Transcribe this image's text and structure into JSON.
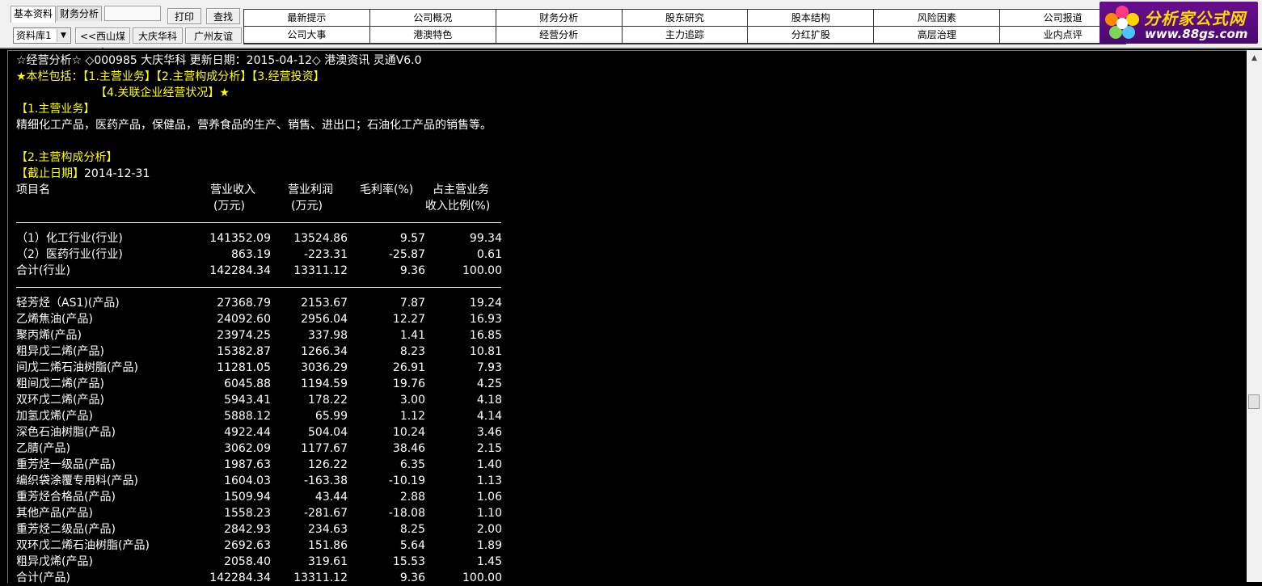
{
  "toolbar": {
    "tabs": [
      "基本资料",
      "财务分析"
    ],
    "print_label": "打印",
    "search_label": "查找",
    "select_value": "资料库1",
    "prev_stock": "<<西山煤电",
    "current_stock": "大庆华科",
    "next_stock": "广州友谊>>",
    "menu_row1": [
      "最新提示",
      "公司概况",
      "财务分析",
      "股东研究",
      "股本结构",
      "风险因素",
      "公司报道"
    ],
    "menu_row2": [
      "公司大事",
      "港澳特色",
      "经营分析",
      "主力追踪",
      "分红扩股",
      "高层治理",
      "业内点评"
    ]
  },
  "logo": {
    "name": "分析家公式网",
    "url": "www.88gs.com"
  },
  "content": {
    "title_line": "☆经营分析☆ ◇000985 大庆华科 更新日期：2015-04-12◇ 港澳资讯 灵通V6.0",
    "includes_line1": "★本栏包括：【1.主营业务】【2.主营构成分析】【3.经营投资】",
    "includes_line2": "【4.关联企业经营状况】★",
    "section1_title": "【1.主营业务】",
    "section1_body": "精细化工产品，医药产品，保健品，营养食品的生产、销售、进出口；石油化工产品的销售等。",
    "section2_title": "【2.主营构成分析】",
    "cutoff_label": "【截止日期】",
    "cutoff_date": "2014-12-31",
    "table_headers": {
      "name": "项目名",
      "revenue": "营业收入",
      "revenue_unit": "(万元)",
      "profit": "营业利润",
      "profit_unit": "(万元)",
      "margin": "毛利率(%)",
      "share": "占主营业务",
      "share_unit": "收入比例(%)"
    },
    "industry_rows": [
      {
        "name": "（1）化工行业(行业)",
        "revenue": "141352.09",
        "profit": "13524.86",
        "margin": "9.57",
        "share": "99.34"
      },
      {
        "name": "（2）医药行业(行业)",
        "revenue": "863.19",
        "profit": "-223.31",
        "margin": "-25.87",
        "share": "0.61"
      },
      {
        "name": "合计(行业)",
        "revenue": "142284.34",
        "profit": "13311.12",
        "margin": "9.36",
        "share": "100.00"
      }
    ],
    "product_rows": [
      {
        "name": "轻芳烃（AS1)(产品)",
        "revenue": "27368.79",
        "profit": "2153.67",
        "margin": "7.87",
        "share": "19.24"
      },
      {
        "name": "乙烯焦油(产品)",
        "revenue": "24092.60",
        "profit": "2956.04",
        "margin": "12.27",
        "share": "16.93"
      },
      {
        "name": "聚丙烯(产品)",
        "revenue": "23974.25",
        "profit": "337.98",
        "margin": "1.41",
        "share": "16.85"
      },
      {
        "name": "粗异戊二烯(产品)",
        "revenue": "15382.87",
        "profit": "1266.34",
        "margin": "8.23",
        "share": "10.81"
      },
      {
        "name": "间戊二烯石油树脂(产品)",
        "revenue": "11281.05",
        "profit": "3036.29",
        "margin": "26.91",
        "share": "7.93"
      },
      {
        "name": "粗间戊二烯(产品)",
        "revenue": "6045.88",
        "profit": "1194.59",
        "margin": "19.76",
        "share": "4.25"
      },
      {
        "name": "双环戊二烯(产品)",
        "revenue": "5943.41",
        "profit": "178.22",
        "margin": "3.00",
        "share": "4.18"
      },
      {
        "name": "加氢戊烯(产品)",
        "revenue": "5888.12",
        "profit": "65.99",
        "margin": "1.12",
        "share": "4.14"
      },
      {
        "name": "深色石油树脂(产品)",
        "revenue": "4922.44",
        "profit": "504.04",
        "margin": "10.24",
        "share": "3.46"
      },
      {
        "name": "乙腈(产品)",
        "revenue": "3062.09",
        "profit": "1177.67",
        "margin": "38.46",
        "share": "2.15"
      },
      {
        "name": "重芳烃一级品(产品)",
        "revenue": "1987.63",
        "profit": "126.22",
        "margin": "6.35",
        "share": "1.40"
      },
      {
        "name": "编织袋涂覆专用料(产品)",
        "revenue": "1604.03",
        "profit": "-163.38",
        "margin": "-10.19",
        "share": "1.13"
      },
      {
        "name": "重芳烃合格品(产品)",
        "revenue": "1509.94",
        "profit": "43.44",
        "margin": "2.88",
        "share": "1.06"
      },
      {
        "name": "其他产品(产品)",
        "revenue": "1558.23",
        "profit": "-281.67",
        "margin": "-18.08",
        "share": "1.10"
      },
      {
        "name": "重芳烃二级品(产品)",
        "revenue": "2842.93",
        "profit": "234.63",
        "margin": "8.25",
        "share": "2.00"
      },
      {
        "name": "双环戊二烯石油树脂(产品)",
        "revenue": "2692.63",
        "profit": "151.86",
        "margin": "5.64",
        "share": "1.89"
      },
      {
        "name": "粗异戊烯(产品)",
        "revenue": "2058.40",
        "profit": "319.61",
        "margin": "15.53",
        "share": "1.45"
      },
      {
        "name": "合计(产品)",
        "revenue": "142284.34",
        "profit": "13311.12",
        "margin": "9.36",
        "share": "100.00"
      }
    ]
  }
}
